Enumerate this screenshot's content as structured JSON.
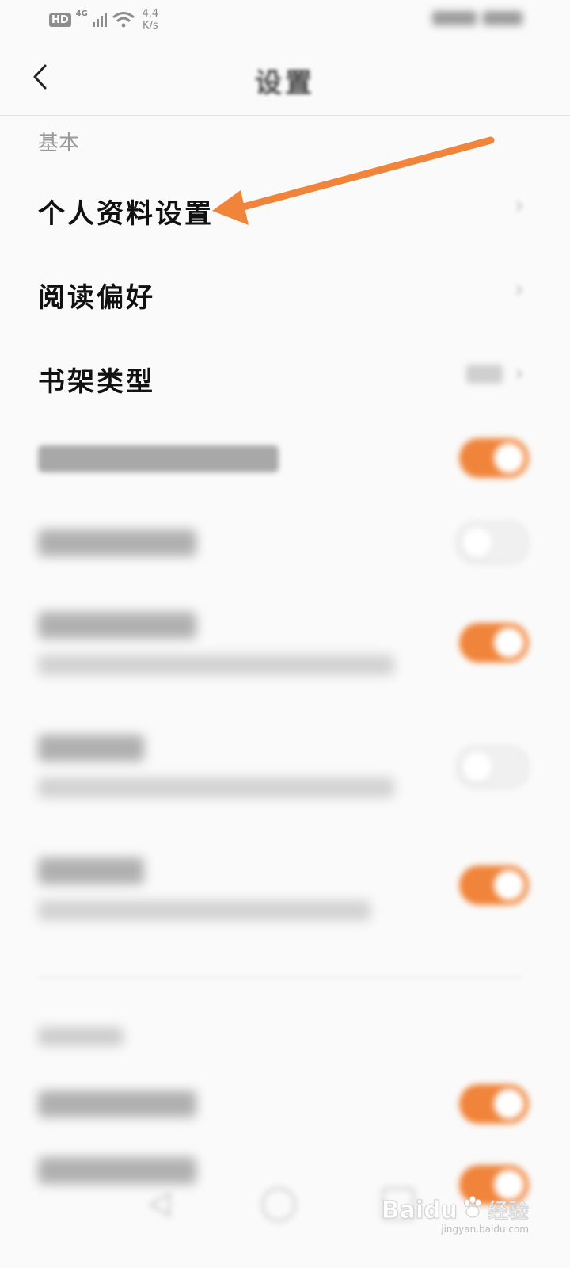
{
  "status_bar": {
    "hd": "HD",
    "network": "4G",
    "speed_value": "4.4",
    "speed_unit": "K/s"
  },
  "nav": {
    "title": "设置"
  },
  "sections": {
    "basic_label": "基本"
  },
  "rows": {
    "profile": {
      "label": "个人资料设置"
    },
    "reading_pref": {
      "label": "阅读偏好"
    },
    "shelf_type": {
      "label": "书架类型"
    }
  },
  "toggles": {
    "row4": true,
    "row5": false,
    "row6": true,
    "row7": false,
    "row8": true,
    "row9": true,
    "row10": true
  },
  "colors": {
    "accent": "#f0843a",
    "annotation_arrow": "#f0843a"
  },
  "watermark": {
    "brand": "Baidu",
    "product": "经验",
    "url": "jingyan.baidu.com"
  }
}
